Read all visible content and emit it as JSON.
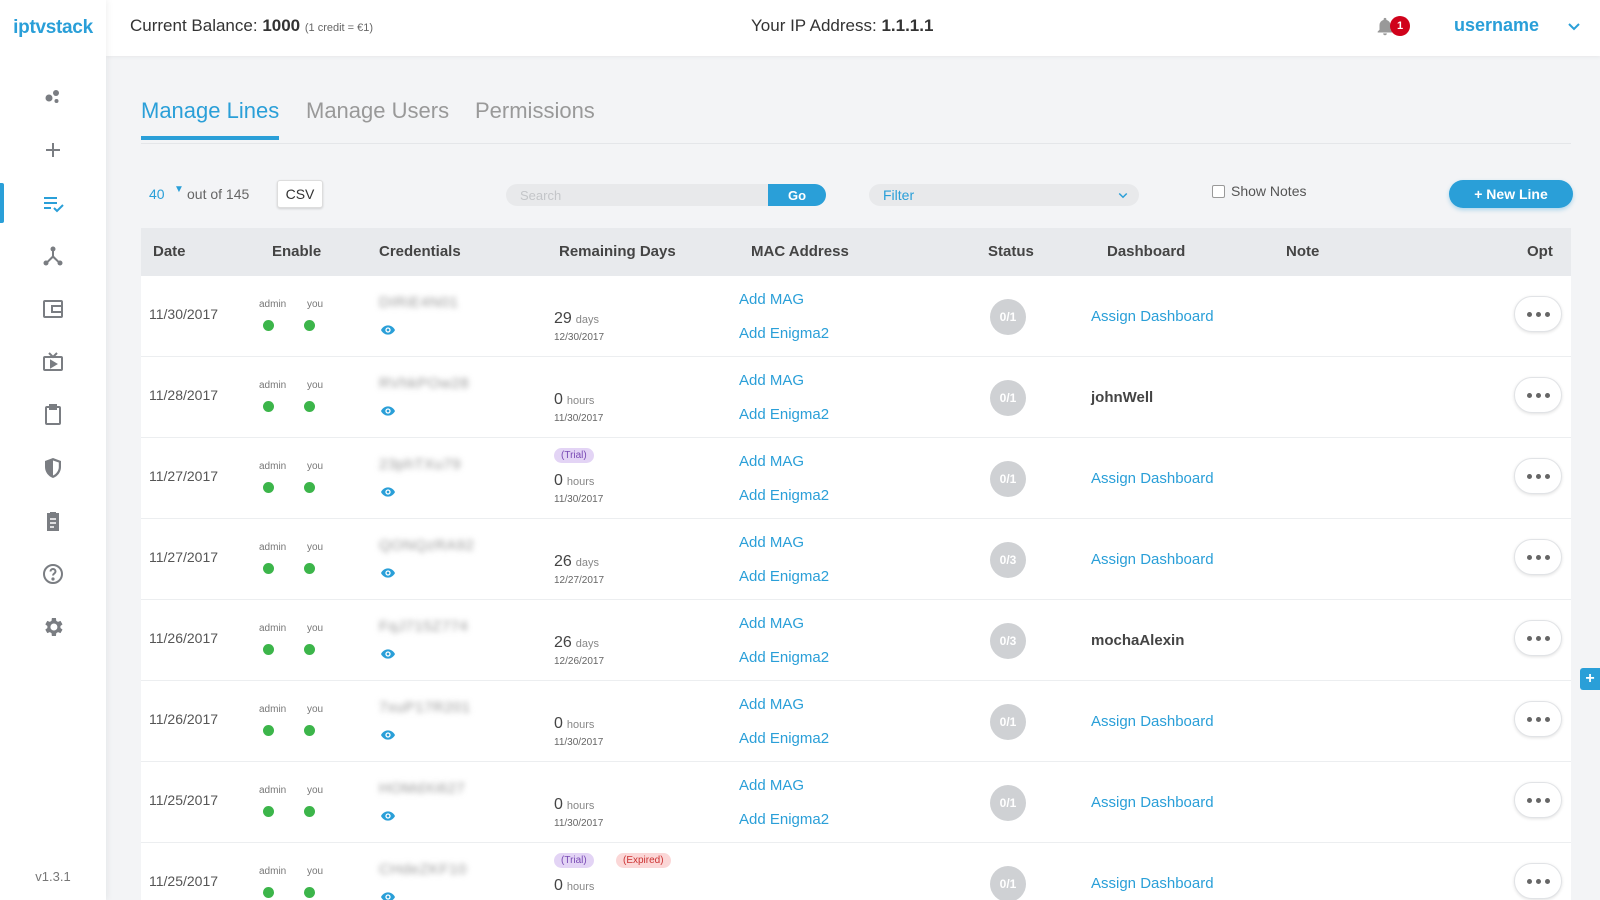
{
  "app": {
    "logo": "iptvstack",
    "version": "v1.3.1"
  },
  "header": {
    "balance_label": "Current Balance:",
    "balance_value": "1000",
    "balance_note": "(1 credit = €1)",
    "ip_label": "Your IP Address:",
    "ip_value": "1.1.1.1",
    "notification_count": "1",
    "username": "username"
  },
  "tabs": [
    {
      "label": "Manage Lines",
      "active": true
    },
    {
      "label": "Manage Users",
      "active": false
    },
    {
      "label": "Permissions",
      "active": false
    }
  ],
  "toolbar": {
    "page_size": "40",
    "out_of": "out of 145",
    "csv_label": "CSV",
    "search_placeholder": "Search",
    "go_label": "Go",
    "filter_label": "Filter",
    "show_notes_label": "Show Notes",
    "new_line_label": "+ New Line"
  },
  "columns": [
    "Date",
    "Enable",
    "Credentials",
    "Remaining Days",
    "MAC Address",
    "Status",
    "Dashboard",
    "Note",
    "Opt"
  ],
  "enable_labels": {
    "admin": "admin",
    "you": "you"
  },
  "mac_links": {
    "mag": "Add MAG",
    "enigma": "Add Enigma2"
  },
  "rows": [
    {
      "date": "11/30/2017",
      "credentials": "DIRiE4N01",
      "remaining": "29",
      "unit": "days",
      "remaining_date": "12/30/2017",
      "status": "0/1",
      "dashboard": "Assign Dashboard",
      "dashboard_assigned": false,
      "tags": []
    },
    {
      "date": "11/28/2017",
      "credentials": "RVhkPOw28",
      "remaining": "0",
      "unit": "hours",
      "remaining_date": "11/30/2017",
      "status": "0/1",
      "dashboard": "johnWell",
      "dashboard_assigned": true,
      "tags": []
    },
    {
      "date": "11/27/2017",
      "credentials": "23phTXu79",
      "remaining": "0",
      "unit": "hours",
      "remaining_date": "11/30/2017",
      "status": "0/1",
      "dashboard": "Assign Dashboard",
      "dashboard_assigned": false,
      "tags": [
        "(Trial)"
      ]
    },
    {
      "date": "11/27/2017",
      "credentials": "QONQzRA92",
      "remaining": "26",
      "unit": "days",
      "remaining_date": "12/27/2017",
      "status": "0/3",
      "dashboard": "Assign Dashboard",
      "dashboard_assigned": false,
      "tags": []
    },
    {
      "date": "11/26/2017",
      "credentials": "FqJ715Z774",
      "remaining": "26",
      "unit": "days",
      "remaining_date": "12/26/2017",
      "status": "0/3",
      "dashboard": "mochaAlexin",
      "dashboard_assigned": true,
      "tags": []
    },
    {
      "date": "11/26/2017",
      "credentials": "7xuP17R201",
      "remaining": "0",
      "unit": "hours",
      "remaining_date": "11/30/2017",
      "status": "0/1",
      "dashboard": "Assign Dashboard",
      "dashboard_assigned": false,
      "tags": []
    },
    {
      "date": "11/25/2017",
      "credentials": "HOMdXi627",
      "remaining": "0",
      "unit": "hours",
      "remaining_date": "11/30/2017",
      "status": "0/1",
      "dashboard": "Assign Dashboard",
      "dashboard_assigned": false,
      "tags": []
    },
    {
      "date": "11/25/2017",
      "credentials": "CHdeZKF10",
      "remaining": "0",
      "unit": "hours",
      "remaining_date": "",
      "status": "0/1",
      "dashboard": "Assign Dashboard",
      "dashboard_assigned": false,
      "tags": [
        "(Trial)",
        "(Expired)"
      ]
    }
  ],
  "sidebar_icons": [
    "dashboard-icon",
    "add-icon",
    "lines-icon",
    "resellers-icon",
    "wallet-icon",
    "tv-icon",
    "clipboard-icon",
    "shield-icon",
    "logs-icon",
    "help-icon",
    "settings-icon"
  ],
  "colors": {
    "accent": "#2a9fd8",
    "enabled": "#3cb54a",
    "alert": "#d0021b"
  }
}
